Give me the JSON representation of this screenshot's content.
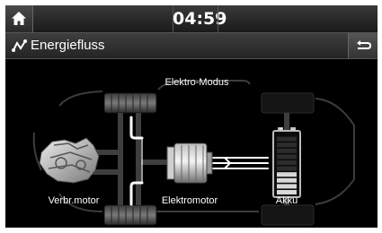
{
  "header": {
    "time": "04:59"
  },
  "titlebar": {
    "title": "Energiefluss"
  },
  "energy_flow": {
    "mode": "Elektro-Modus",
    "engine_label": "Verbr.motor",
    "motor_label": "Elektromotor",
    "battery_label": "Akku",
    "battery_charge": 0.4
  },
  "icons": {
    "home": "home-icon",
    "flow": "energy-flow-icon",
    "back": "back-arrow-icon"
  }
}
